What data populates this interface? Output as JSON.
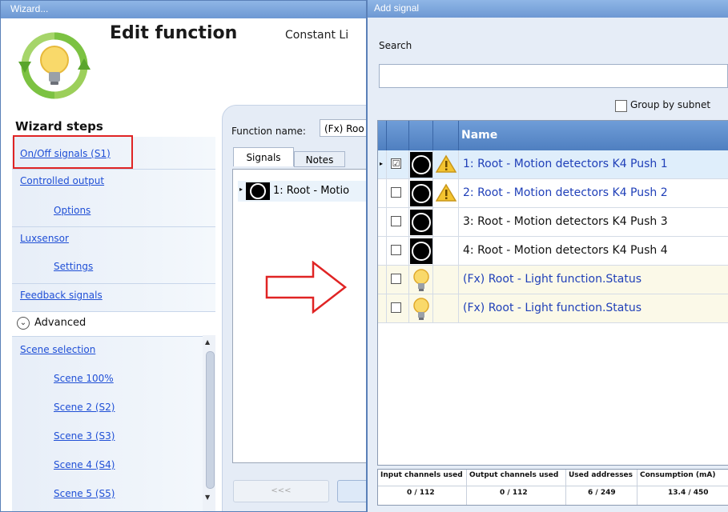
{
  "wizard": {
    "window_title": "Wizard...",
    "heading": "Edit function",
    "function_type": "Constant Li",
    "steps_heading": "Wizard steps",
    "steps": [
      {
        "label": "On/Off signals (S1)",
        "selected": true
      },
      {
        "label": "Controlled output"
      },
      {
        "label": "Options"
      },
      {
        "label": "Luxsensor"
      },
      {
        "label": "Settings"
      },
      {
        "label": "Feedback signals"
      }
    ],
    "advanced_label": "Advanced",
    "advanced_steps": [
      {
        "label": "Scene selection"
      },
      {
        "label": "Scene 100%"
      },
      {
        "label": "Scene 2 (S2)"
      },
      {
        "label": "Scene 3 (S3)"
      },
      {
        "label": "Scene 4 (S4)"
      },
      {
        "label": "Scene 5 (S5)"
      }
    ],
    "function_name_label": "Function name:",
    "function_name_value": "(Fx) Roo",
    "tabs": {
      "signals": "Signals",
      "notes": "Notes"
    },
    "signal_rows": [
      "1: Root - Motio"
    ],
    "back_button": "<<<",
    "accent": "#1f4fd6"
  },
  "dialog": {
    "window_title": "Add signal",
    "search_label": "Search",
    "search_value": "",
    "group_by_subnet": "Group by subnet",
    "column_name": "Name",
    "rows": [
      {
        "label": "1: Root - Motion detectors K4 Push 1",
        "checked": true,
        "icon": "motion-detector-icon",
        "warning": true
      },
      {
        "label": "2: Root - Motion detectors K4 Push 2",
        "checked": false,
        "icon": "motion-detector-icon",
        "warning": true
      },
      {
        "label": "3: Root - Motion detectors K4 Push 3",
        "checked": false,
        "icon": "motion-detector-icon",
        "warning": false
      },
      {
        "label": "4: Root - Motion detectors K4 Push 4",
        "checked": false,
        "icon": "motion-detector-icon",
        "warning": false
      },
      {
        "label": "(Fx) Root - Light function.Status",
        "checked": false,
        "icon": "light-bulb-icon",
        "warning": false
      },
      {
        "label": "(Fx) Root - Light function.Status",
        "checked": false,
        "icon": "light-bulb-icon",
        "warning": false
      }
    ],
    "footer": {
      "headers": [
        "Input channels used",
        "Output channels used",
        "Used addresses",
        "Consumption (mA)"
      ],
      "values": [
        "0 / 112",
        "0 / 112",
        "6 / 249",
        "13.4 / 450"
      ]
    },
    "check_mark": "☑"
  }
}
